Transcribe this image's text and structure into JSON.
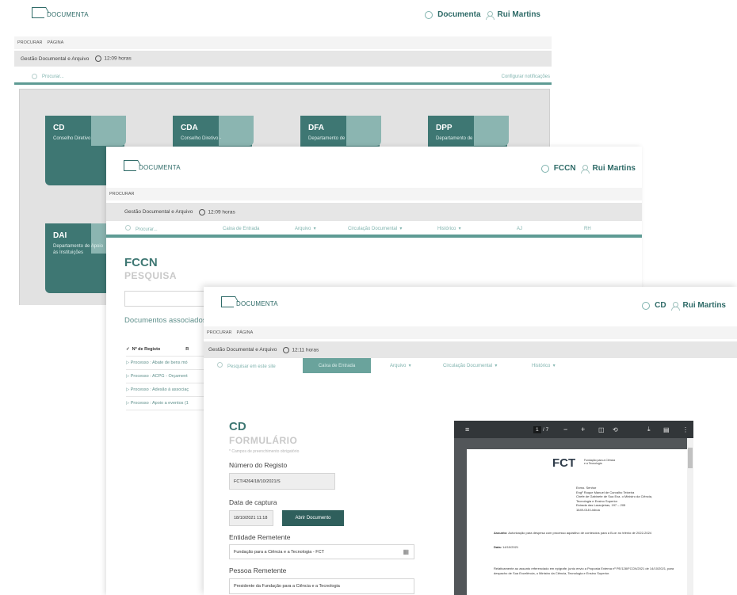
{
  "w1": {
    "logo": "DOCUMENTA",
    "context": "Documenta",
    "user": "Rui Martins",
    "menu": [
      "PROCURAR",
      "PÁGINA"
    ],
    "site": "Gestão Documental e Arquivo",
    "time": "12:09 horas",
    "search_placeholder": "Procurar...",
    "notify": "Configurar notificações",
    "tiles": [
      {
        "code": "CD",
        "desc": "Conselho Diretivo"
      },
      {
        "code": "CDA",
        "desc": "Conselho Diretivo -"
      },
      {
        "code": "DFA",
        "desc": "Departamento de"
      },
      {
        "code": "DPP",
        "desc": "Departamento de"
      },
      {
        "code": "DAI",
        "desc": "Departamento de Apoio às Instituições"
      }
    ]
  },
  "w2": {
    "logo": "DOCUMENTA",
    "context": "FCCN",
    "user": "Rui Martins",
    "menu": [
      "PROCURAR"
    ],
    "site": "Gestão Documental e Arquivo",
    "time": "12:09 horas",
    "nav": [
      "Procurar...",
      "Caixa de Entrada",
      "Arquivo",
      "Circulação Documental",
      "Histórico",
      "AJ",
      "RH"
    ],
    "title": "FCCN",
    "subtitle": "PESQUISA",
    "docs_heading": "Documentos associados",
    "col_header": "Nº de Registo",
    "col_header2": "R",
    "rows": [
      "Processo : Abate de bens mó",
      "Processo : ACPG - Orçament",
      "Processo : Adesão à associaç",
      "Processo : Apoio a eventos (1"
    ]
  },
  "w3": {
    "logo": "DOCUMENTA",
    "context": "CD",
    "user": "Rui Martins",
    "menu": [
      "PROCURAR",
      "PÁGINA"
    ],
    "site": "Gestão Documental e Arquivo",
    "time": "12:11 horas",
    "nav": [
      "Pesquisar em este site",
      "Caixa de Entrada",
      "Arquivo",
      "Circulação Documental",
      "Histórico"
    ],
    "title": "CD",
    "subtitle": "FORMULÁRIO",
    "required_note": "* Campos de preenchimento obrigatório",
    "fields": {
      "registo_label": "Número do Registo",
      "registo_value": "FCT/4264/18/10/2021/S",
      "captura_label": "Data de captura",
      "captura_value": "18/10/2021 11:18",
      "open_button": "Abrir Documento",
      "entidade_label": "Entidade Remetente",
      "entidade_value": "Fundação para a Ciência e a Tecnologia - FCT",
      "pessoa_label": "Pessoa Remetente",
      "pessoa_value": "Presidente da Fundação para a Ciência e a Tecnologia"
    },
    "pdf": {
      "page_current": "1",
      "page_total": "/ 7",
      "brand": "FCT",
      "brand_sub": "Fundação para a Ciência e a Tecnologia",
      "address": [
        "Exmo. Senhor",
        "Engº Roque Manuel de Carvalho Teixeira",
        "Chefe de Gabinete de Sua Exa. o Ministro da Ciência,",
        "Tecnologia e Ensino Superior",
        "Estrada das Laranjeiras, 197 – 205",
        "1649-018 Lisboa"
      ],
      "assunto_label": "Assunto:",
      "assunto_text": "Autorização para despesa com processo aquisitivo de conteúdos para a B-on no triénio de 2022-2024",
      "data_label": "Data:",
      "data_text": "14/10/2021",
      "body": "Relativamente ao assunto referenciado em epígrafe, junto envio a Proposta Externa nº PE/128/FCCN/2021 de 14/10/2021, para despacho de Sua Excelência, o Ministro da Ciência, Tecnologia e Ensino Superior."
    }
  },
  "colors": {
    "accent": "#3e7773",
    "accent_light": "#8bb5b1",
    "nav_active": "#6aa39c"
  }
}
